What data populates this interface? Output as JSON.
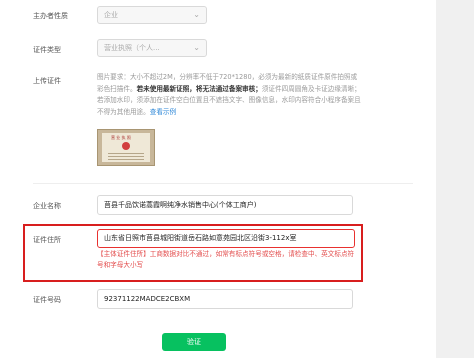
{
  "form": {
    "subject_nature": {
      "label": "主办者性质",
      "value": "企业"
    },
    "cert_type": {
      "label": "证件类型",
      "value": "营业执照（个人..."
    },
    "upload": {
      "label": "上传证件",
      "tip_prefix": "图片要求：大小不超过2M，分辨率不低于720*1280，必须为最新的纸质证件原件拍照或彩色扫描件。",
      "tip_bold": "若未使用最新证照，将无法通过备案审核；",
      "tip_suffix": "须证件四周圆角及卡证边缘清晰；若添加水印，须添加在证件空白位置且不遮挡文字、图像信息，水印内容符合小程序备案且不得为其他用途。",
      "example_link": "查看示例",
      "license_thumb_title": "营 业 执 照"
    },
    "company_name": {
      "label": "企业名称",
      "value": "莒县千品饮诺蒿霞啊纯净水销售中心(个体工商户)"
    },
    "cert_address": {
      "label": "证件住所",
      "value": "山东省日照市莒县城阳街道岳石路如意苑园北区沿街3-112x室",
      "error": "【主体证件住所】工商数据对比不通过，如常有标点符号或空格，请检查中、英文标点符号和字母大小写"
    },
    "cert_number": {
      "label": "证件号码",
      "value": "92371122MADCE2CBXM"
    },
    "verify_button": "验证"
  }
}
